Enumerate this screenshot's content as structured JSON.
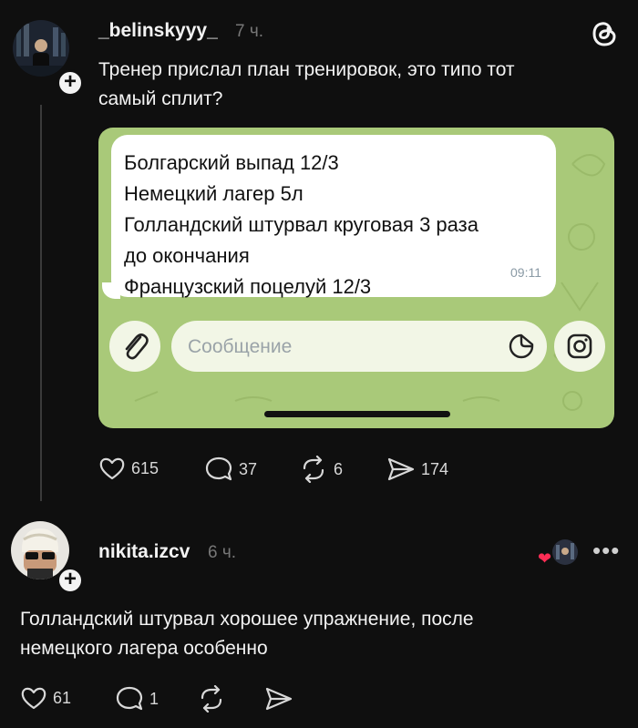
{
  "post": {
    "username": "_belinskyyy_",
    "time": "7 ч.",
    "text_line1": "Тренер прислал план тренировок, это типо тот",
    "text_line2": "самый сплит?",
    "screenshot": {
      "message_lines": [
        "Болгарский выпад 12/3",
        "Немецкий лагер 5л",
        "Голландский штурвал круговая 3 раза",
        "до окончания",
        "Французский поцелуй 12/3"
      ],
      "message_time": "09:11",
      "input_placeholder": "Сообщение",
      "background_color": "#a9c979"
    },
    "actions": {
      "likes": "615",
      "comments": "37",
      "reposts": "6",
      "shares": "174"
    }
  },
  "reply": {
    "username": "nikita.izcv",
    "time": "6 ч.",
    "text_line1": "Голландский штурвал хорошее упражнение, после",
    "text_line2": "немецкого лагера особенно",
    "actions": {
      "likes": "61",
      "comments": "1"
    }
  },
  "icons": {
    "app_logo": "threads-icon",
    "like": "heart-icon",
    "comment": "comment-icon",
    "repost": "repost-icon",
    "share": "send-icon",
    "attach": "paperclip-icon",
    "sticker": "sticker-icon",
    "instagram": "instagram-icon",
    "more": "more-icon"
  },
  "colors": {
    "background": "#0f0f0f",
    "text": "#f3f3f3",
    "muted": "#777777",
    "liked_heart": "#ff2d55"
  }
}
